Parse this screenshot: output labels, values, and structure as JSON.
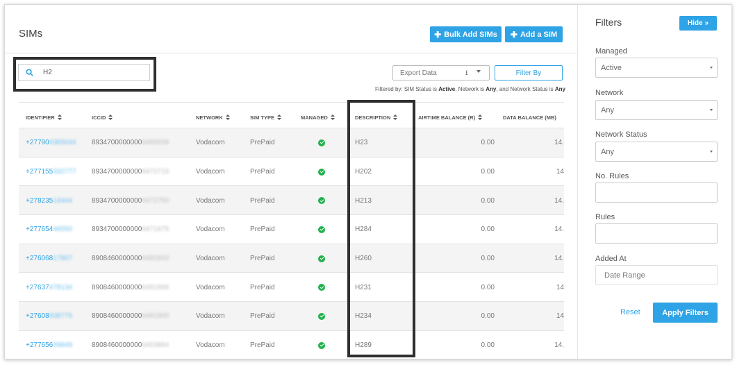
{
  "header": {
    "title": "SIMs",
    "bulk_add_label": "Bulk Add SIMs",
    "add_sim_label": "Add a SIM"
  },
  "search": {
    "value": "H2",
    "icon": "search-icon"
  },
  "toolbar": {
    "export_label": "Export Data",
    "filter_by_label": "Filter By",
    "filtered_prefix": "Filtered by: SIM Status is",
    "filtered_status": "Active",
    "filtered_mid1": ", Network is",
    "filtered_network": "Any",
    "filtered_mid2": ", and Network Status is",
    "filtered_netstatus": "Any"
  },
  "columns": [
    "IDENTIFIER",
    "ICCID",
    "NETWORK",
    "SIM TYPE",
    "MANAGED",
    "DESCRIPTION",
    "AIRTIME BALANCE (R)",
    "DATA BALANCE (MB)"
  ],
  "rows": [
    {
      "id_visible": "+27790",
      "id_blurred": "4365044",
      "iccid_visible": "8934700000000",
      "iccid_blurred": "6469339",
      "network": "Vodacom",
      "sim_type": "PrePaid",
      "managed": true,
      "description": "H23",
      "airtime": "0.00",
      "data": "14."
    },
    {
      "id_visible": "+277155",
      "id_blurred": "332777",
      "iccid_visible": "8934700000000",
      "iccid_blurred": "6472719",
      "network": "Vodacom",
      "sim_type": "PrePaid",
      "managed": true,
      "description": "H202",
      "airtime": "0.00",
      "data": "14"
    },
    {
      "id_visible": "+278235",
      "id_blurred": "14444",
      "iccid_visible": "8934700000000",
      "iccid_blurred": "6472750",
      "network": "Vodacom",
      "sim_type": "PrePaid",
      "managed": true,
      "description": "H213",
      "airtime": "0.00",
      "data": "14."
    },
    {
      "id_visible": "+277654",
      "id_blurred": "46550",
      "iccid_visible": "8934700000000",
      "iccid_blurred": "6471675",
      "network": "Vodacom",
      "sim_type": "PrePaid",
      "managed": true,
      "description": "H284",
      "airtime": "0.00",
      "data": "14."
    },
    {
      "id_visible": "+276068",
      "id_blurred": "17807",
      "iccid_visible": "8908460000000",
      "iccid_blurred": "6491843",
      "network": "Vodacom",
      "sim_type": "PrePaid",
      "managed": true,
      "description": "H260",
      "airtime": "0.00",
      "data": "14."
    },
    {
      "id_visible": "+27637",
      "id_blurred": "478134",
      "iccid_visible": "8908460000000",
      "iccid_blurred": "6491868",
      "network": "Vodacom",
      "sim_type": "PrePaid",
      "managed": true,
      "description": "H231",
      "airtime": "0.00",
      "data": "14"
    },
    {
      "id_visible": "+27608",
      "id_blurred": "838776",
      "iccid_visible": "8908460000000",
      "iccid_blurred": "6491900",
      "network": "Vodacom",
      "sim_type": "PrePaid",
      "managed": true,
      "description": "H234",
      "airtime": "0.00",
      "data": "14"
    },
    {
      "id_visible": "+277656",
      "id_blurred": "59849",
      "iccid_visible": "8908460000000",
      "iccid_blurred": "6453864",
      "network": "Vodacom",
      "sim_type": "PrePaid",
      "managed": true,
      "description": "H289",
      "airtime": "0.00",
      "data": "14."
    }
  ],
  "filters": {
    "title": "Filters",
    "hide_label": "Hide",
    "managed_label": "Managed",
    "managed_value": "Active",
    "network_label": "Network",
    "network_value": "Any",
    "network_status_label": "Network Status",
    "network_status_value": "Any",
    "no_rules_label": "No. Rules",
    "rules_label": "Rules",
    "added_at_label": "Added At",
    "added_at_placeholder": "Date Range",
    "reset_label": "Reset",
    "apply_label": "Apply Filters"
  },
  "colors": {
    "accent": "#2ea3e5",
    "check": "#21b24b",
    "highlight_border": "#2f2f2f"
  }
}
